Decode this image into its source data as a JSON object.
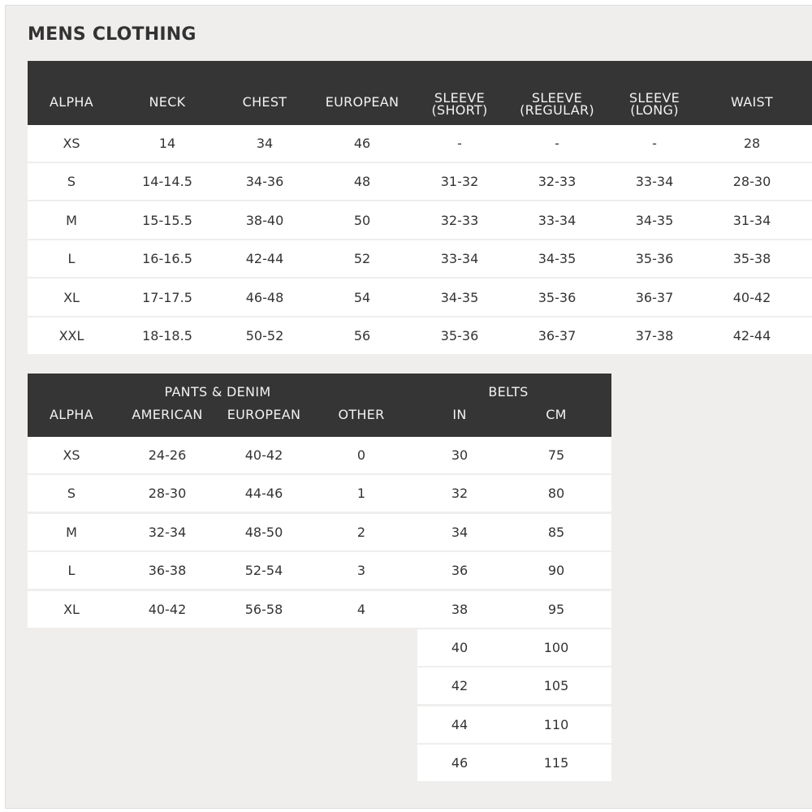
{
  "title": "MENS CLOTHING",
  "tops": {
    "headers": [
      {
        "label": "ALPHA"
      },
      {
        "label": "NECK"
      },
      {
        "label": "CHEST"
      },
      {
        "label": "EUROPEAN"
      },
      {
        "label": "SLEEVE",
        "sub": "(SHORT)"
      },
      {
        "label": "SLEEVE",
        "sub": "(REGULAR)"
      },
      {
        "label": "SLEEVE",
        "sub": "(LONG)"
      },
      {
        "label": "WAIST"
      }
    ],
    "rows": [
      [
        "XS",
        "14",
        "34",
        "46",
        "-",
        "-",
        "-",
        "28"
      ],
      [
        "S",
        "14-14.5",
        "34-36",
        "48",
        "31-32",
        "32-33",
        "33-34",
        "28-30"
      ],
      [
        "M",
        "15-15.5",
        "38-40",
        "50",
        "32-33",
        "33-34",
        "34-35",
        "31-34"
      ],
      [
        "L",
        "16-16.5",
        "42-44",
        "52",
        "33-34",
        "34-35",
        "35-36",
        "35-38"
      ],
      [
        "XL",
        "17-17.5",
        "46-48",
        "54",
        "34-35",
        "35-36",
        "36-37",
        "40-42"
      ],
      [
        "XXL",
        "18-18.5",
        "50-52",
        "56",
        "35-36",
        "36-37",
        "37-38",
        "42-44"
      ]
    ]
  },
  "bottoms": {
    "group_pants": "PANTS & DENIM",
    "group_belts": "BELTS",
    "headers": [
      "ALPHA",
      "AMERICAN",
      "EUROPEAN",
      "OTHER",
      "IN",
      "CM"
    ],
    "rows": [
      [
        "XS",
        "24-26",
        "40-42",
        "0",
        "30",
        "75"
      ],
      [
        "S",
        "28-30",
        "44-46",
        "1",
        "32",
        "80"
      ],
      [
        "M",
        "32-34",
        "48-50",
        "2",
        "34",
        "85"
      ],
      [
        "L",
        "36-38",
        "52-54",
        "3",
        "36",
        "90"
      ],
      [
        "XL",
        "40-42",
        "56-58",
        "4",
        "38",
        "95"
      ]
    ],
    "belt_rows": [
      [
        "40",
        "100"
      ],
      [
        "42",
        "105"
      ],
      [
        "44",
        "110"
      ],
      [
        "46",
        "115"
      ]
    ]
  }
}
